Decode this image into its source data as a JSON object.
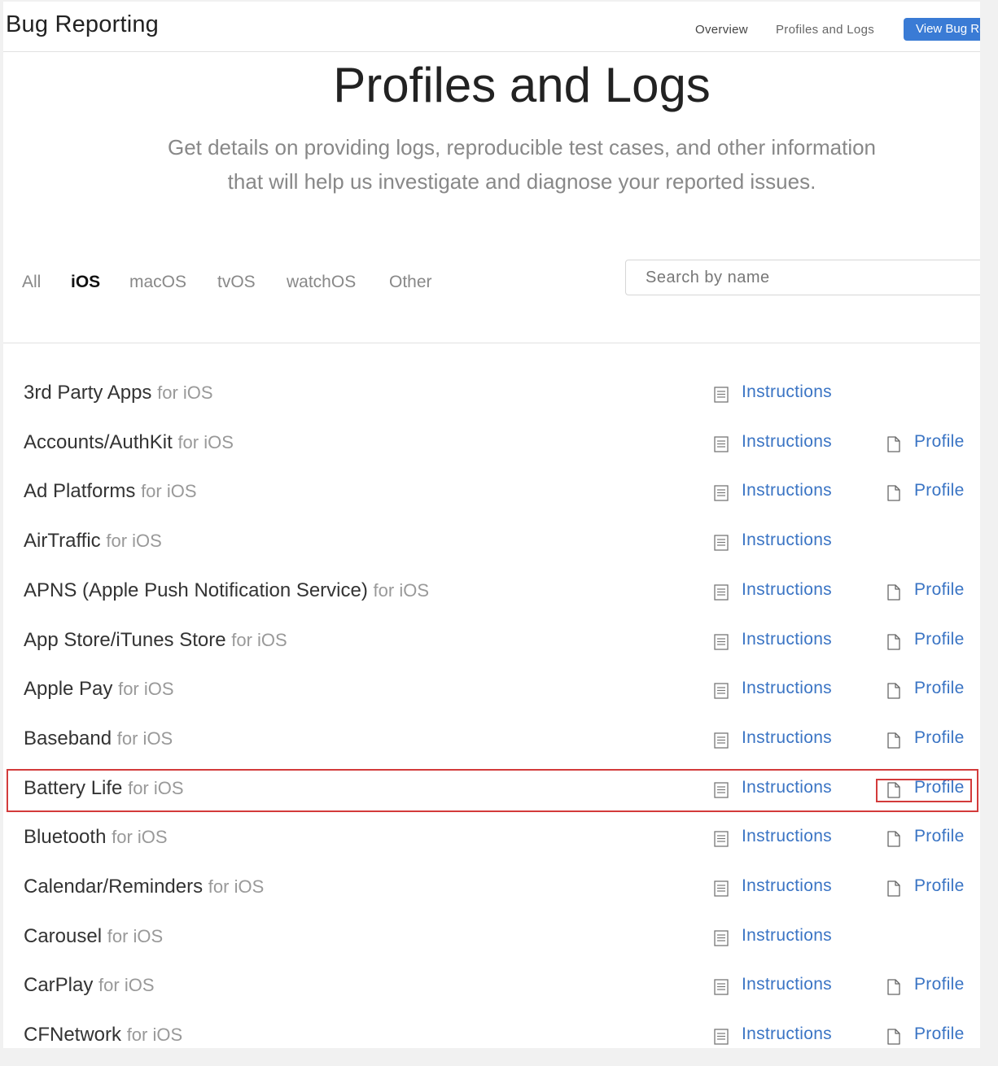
{
  "header": {
    "brand": "Bug Reporting",
    "nav": [
      {
        "label": "Overview"
      },
      {
        "label": "Profiles and Logs"
      }
    ],
    "view_button_label": "View Bug Reports"
  },
  "hero": {
    "title": "Profiles and Logs",
    "subtitle_line1": "Get details on providing logs, reproducible test cases, and other information",
    "subtitle_line2": "that will help us investigate and diagnose your reported issues."
  },
  "filters": {
    "tabs": [
      {
        "label": "All"
      },
      {
        "label": "iOS"
      },
      {
        "label": "macOS"
      },
      {
        "label": "tvOS"
      },
      {
        "label": "watchOS"
      },
      {
        "label": "Other"
      }
    ],
    "active": "iOS",
    "search_placeholder": "Search by name"
  },
  "list": {
    "suffix": "for iOS",
    "instructions_label": "Instructions",
    "profile_label": "Profile",
    "items": [
      {
        "name": "3rd Party Apps",
        "has_profile": false
      },
      {
        "name": "Accounts/AuthKit",
        "has_profile": true
      },
      {
        "name": "Ad Platforms",
        "has_profile": true
      },
      {
        "name": "AirTraffic",
        "has_profile": false
      },
      {
        "name": "APNS (Apple Push Notification Service)",
        "has_profile": true
      },
      {
        "name": "App Store/iTunes Store",
        "has_profile": true
      },
      {
        "name": "Apple Pay",
        "has_profile": true
      },
      {
        "name": "Baseband",
        "has_profile": true
      },
      {
        "name": "Battery Life",
        "has_profile": true,
        "highlighted": true
      },
      {
        "name": "Bluetooth",
        "has_profile": true
      },
      {
        "name": "Calendar/Reminders",
        "has_profile": true
      },
      {
        "name": "Carousel",
        "has_profile": false
      },
      {
        "name": "CarPlay",
        "has_profile": true
      },
      {
        "name": "CFNetwork",
        "has_profile": true
      }
    ]
  },
  "colors": {
    "link": "#3a74c4",
    "button": "#3a7bd5",
    "highlight": "#d33b3b"
  },
  "icons": {
    "instructions": "list-doc-icon",
    "profile": "file-icon"
  }
}
